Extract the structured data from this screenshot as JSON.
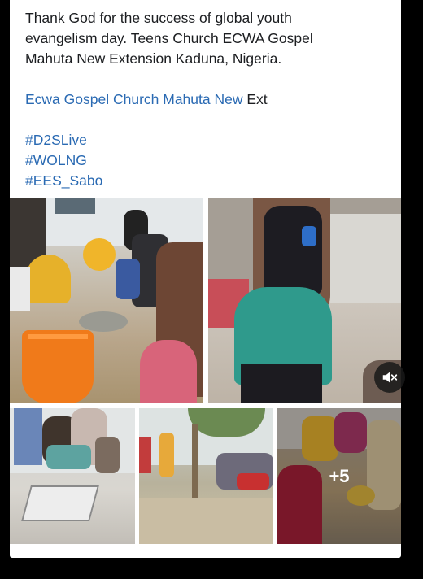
{
  "post": {
    "lines": [
      "Thank God for the success of global youth",
      "evangelism day. Teens Church ECWA Gospel",
      "Mahuta New Extension Kaduna, Nigeria."
    ],
    "mention_link": "Ecwa Gospel Church Mahuta New",
    "mention_suffix": " Ext",
    "hashtags": [
      "#D2SLive",
      "#WOLNG",
      "#EES_Sabo"
    ]
  },
  "media": {
    "more_count": "+5",
    "mute_icon": "speaker-mute-icon"
  }
}
